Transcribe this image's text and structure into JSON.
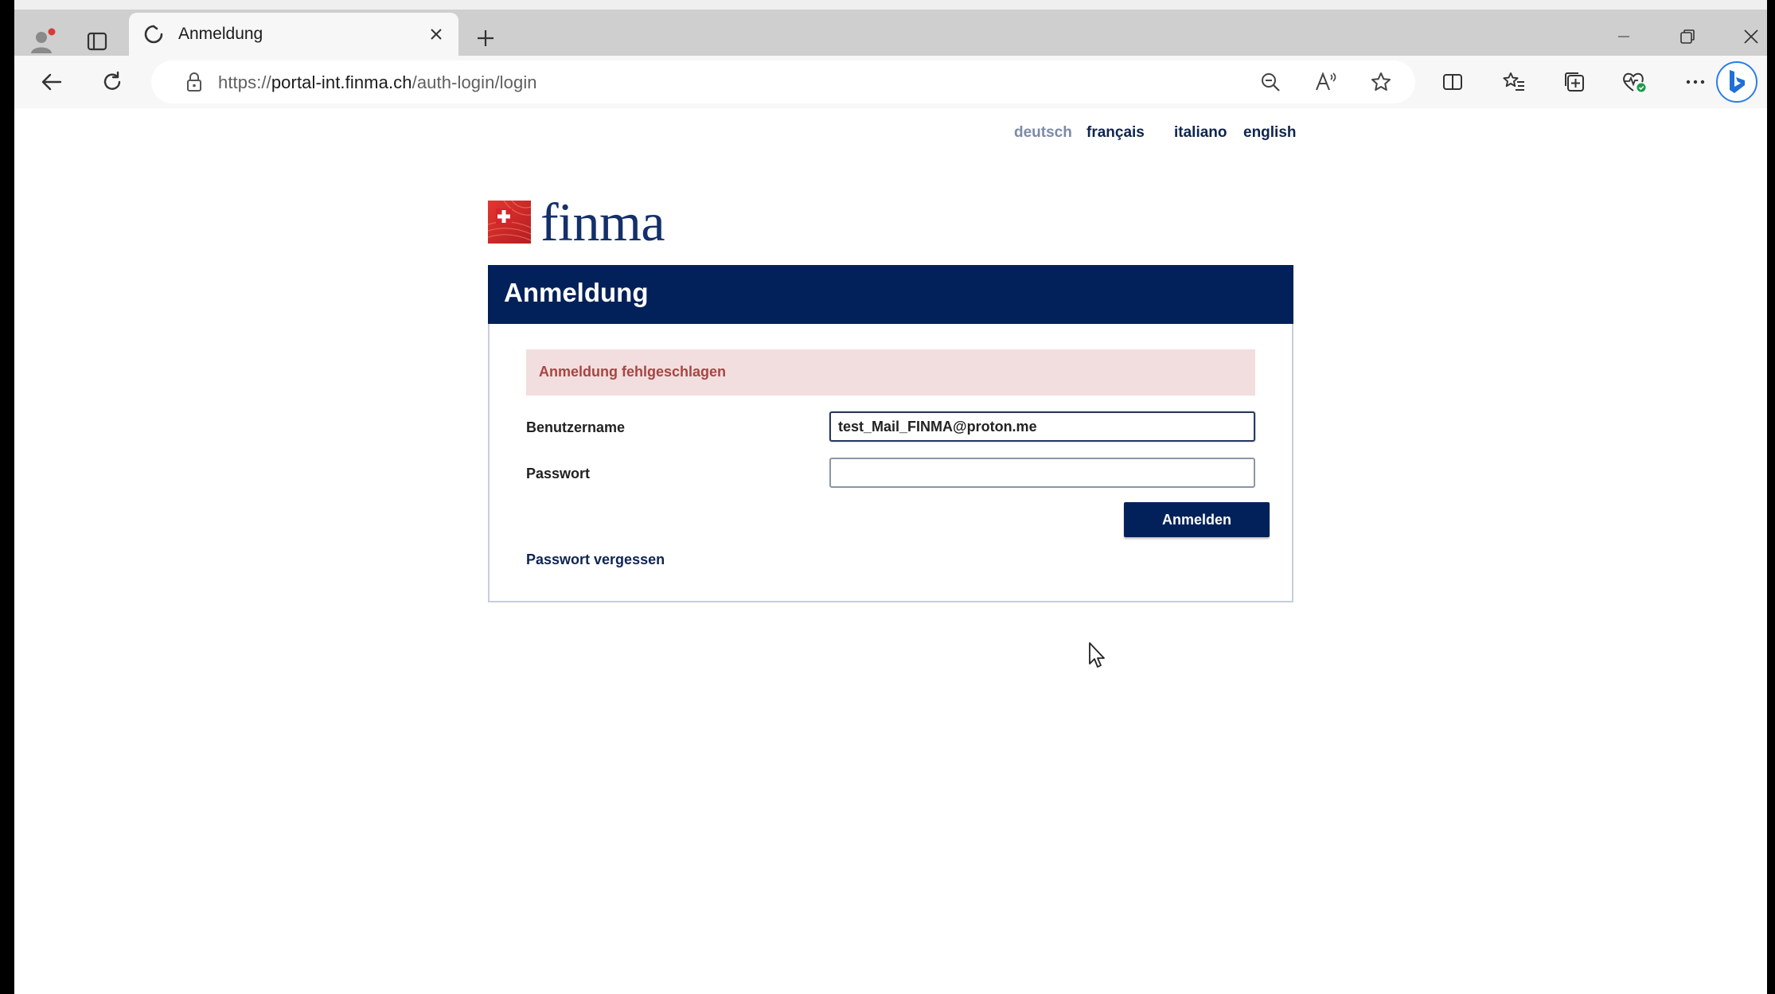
{
  "browser": {
    "tab": {
      "title": "Anmeldung"
    },
    "address": {
      "scheme": "https://",
      "host": "portal-int.finma.ch",
      "path": "/auth-login/login"
    }
  },
  "page": {
    "languages": [
      {
        "label": "deutsch",
        "active": true
      },
      {
        "label": "français",
        "active": false
      },
      {
        "label": "italiano",
        "active": false
      },
      {
        "label": "english",
        "active": false
      }
    ],
    "logo": {
      "text": "finma"
    },
    "login": {
      "title": "Anmeldung",
      "error": "Anmeldung fehlgeschlagen",
      "username_label": "Benutzername",
      "username_value": "test_Mail_FINMA@proton.me",
      "password_label": "Passwort",
      "password_value": "",
      "submit_label": "Anmelden",
      "forgot_label": "Passwort vergessen"
    }
  },
  "colors": {
    "header_navy": "#02215a",
    "error_bg": "#f2dede",
    "error_text": "#a94442",
    "logo_red": "#d8232a"
  }
}
